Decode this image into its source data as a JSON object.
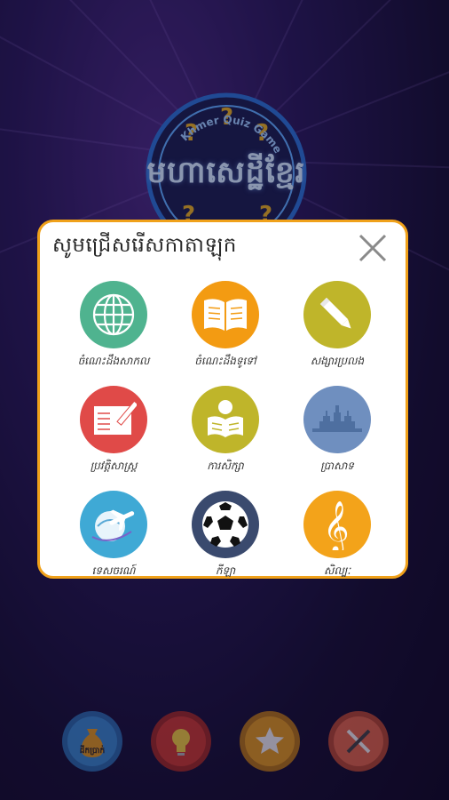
{
  "background": {
    "colors": [
      "#2a1a5e",
      "#120a2a"
    ]
  },
  "logo": {
    "ring_text": "Khmer Quiz Game",
    "title": "មហាសេដ្ឋីខ្មែរ",
    "icon": "question-marks-clock-icon"
  },
  "dialog": {
    "title": "សូមជ្រើសរើសកាតាឡុក",
    "close_icon": "close-icon",
    "accent_color": "#f0a11a",
    "categories": [
      {
        "label": "ចំណេះដឹងសាកល",
        "icon": "globe-icon",
        "color": "#4fb38f"
      },
      {
        "label": "ចំណេះដឹងទូទៅ",
        "icon": "open-book-icon",
        "color": "#f39b12"
      },
      {
        "label": "សង្សារប្រលង",
        "icon": "pencil-icon",
        "color": "#bfb52a"
      },
      {
        "label": "ប្រវត្តិសាស្ត្រ",
        "icon": "notebook-pen-icon",
        "color": "#e04a48"
      },
      {
        "label": "ការសិក្សា",
        "icon": "reading-person-icon",
        "color": "#bfb52a"
      },
      {
        "label": "ប្រាសាទ",
        "icon": "temple-skyline-icon",
        "color": "#6f8fbf"
      },
      {
        "label": "ទេសចរណ៍",
        "icon": "airplane-globe-icon",
        "color": "#3fa9d5"
      },
      {
        "label": "កីឡា",
        "icon": "soccer-ball-icon",
        "color": "#3a4a6e"
      },
      {
        "label": "សិល្បៈ",
        "icon": "treble-clef-icon",
        "color": "#f3a31a"
      }
    ]
  },
  "bottom_bar": {
    "buttons": [
      {
        "name": "account",
        "label": "ដីកប្រាក់",
        "icon": "money-bag-icon",
        "color": "#3a8fd6"
      },
      {
        "name": "hint",
        "label": "",
        "icon": "lightbulb-icon",
        "color": "#d83a2a"
      },
      {
        "name": "rate",
        "label": "",
        "icon": "star-icon",
        "color": "#f0a11a"
      },
      {
        "name": "settings",
        "label": "",
        "icon": "tools-icon",
        "color": "#f06a4a"
      }
    ]
  }
}
